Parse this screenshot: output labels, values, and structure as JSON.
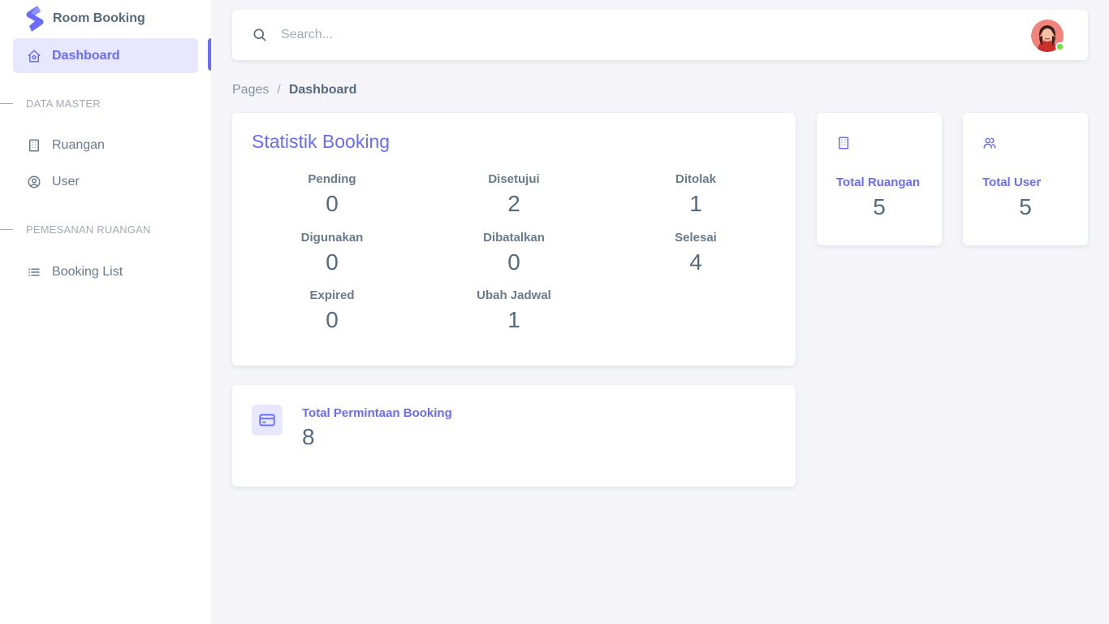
{
  "brand": {
    "name": "Room Booking"
  },
  "sidebar": {
    "items": [
      {
        "label": "Dashboard",
        "icon": "home-icon",
        "active": true
      },
      {
        "label": "Ruangan",
        "icon": "building-icon"
      },
      {
        "label": "User",
        "icon": "user-circle-icon"
      },
      {
        "label": "Booking List",
        "icon": "list-icon"
      }
    ],
    "headers": [
      "DATA MASTER",
      "PEMESANAN RUANGAN"
    ]
  },
  "navbar": {
    "search_placeholder": "Search...",
    "avatar_status": "online"
  },
  "breadcrumb": {
    "parent": "Pages",
    "separator": "/",
    "current": "Dashboard"
  },
  "statistik": {
    "title": "Statistik Booking",
    "items": [
      {
        "label": "Pending",
        "value": "0"
      },
      {
        "label": "Disetujui",
        "value": "2"
      },
      {
        "label": "Ditolak",
        "value": "1"
      },
      {
        "label": "Digunakan",
        "value": "0"
      },
      {
        "label": "Dibatalkan",
        "value": "0"
      },
      {
        "label": "Selesai",
        "value": "4"
      },
      {
        "label": "Expired",
        "value": "0"
      },
      {
        "label": "Ubah Jadwal",
        "value": "1"
      }
    ]
  },
  "total_ruangan": {
    "label": "Total Ruangan",
    "value": "5",
    "icon": "building-icon"
  },
  "total_user": {
    "label": "Total User",
    "value": "5",
    "icon": "users-icon"
  },
  "total_permintaan": {
    "label": "Total Permintaan Booking",
    "value": "8",
    "icon": "credit-card-icon"
  },
  "colors": {
    "primary": "#696cff",
    "primary_light": "#e7e7ff",
    "text": "#566a7f",
    "muted": "#a1acb8",
    "online": "#71dd37",
    "background": "#f5f5f9"
  }
}
